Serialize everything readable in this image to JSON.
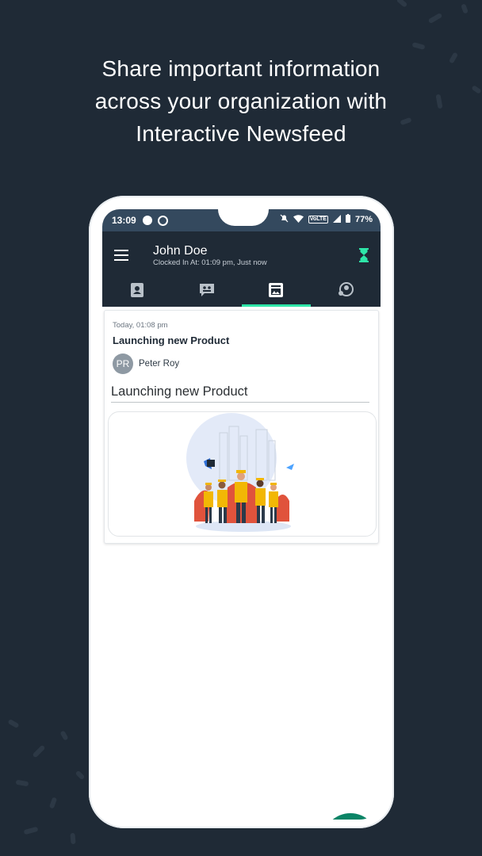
{
  "headline": {
    "line1": "Share important information",
    "line2": "across your organization with",
    "line3": "Interactive Newsfeed"
  },
  "status_bar": {
    "time": "13:09",
    "battery": "77%",
    "network_badge": "VoLTE"
  },
  "app_bar": {
    "user_name": "John Doe",
    "clocked_in": "Clocked In At: 01:09 pm, Just now",
    "accent_color": "#2ee6a8",
    "icons": [
      "menu-icon",
      "hourglass-icon"
    ]
  },
  "tabs": [
    {
      "icon": "contacts-icon",
      "active": false
    },
    {
      "icon": "chat-icon",
      "active": false
    },
    {
      "icon": "newsfeed-icon",
      "active": true
    },
    {
      "icon": "team-icon",
      "active": false
    }
  ],
  "post": {
    "date": "Today, 01:08 pm",
    "title": "Launching new Product",
    "author_initials": "PR",
    "author_name": "Peter Roy",
    "body_heading": "Launching new Product",
    "image": "workers-launch-illustration"
  },
  "fab": {
    "icon": "walkie-talkie-icon",
    "color": "#0b8466"
  }
}
